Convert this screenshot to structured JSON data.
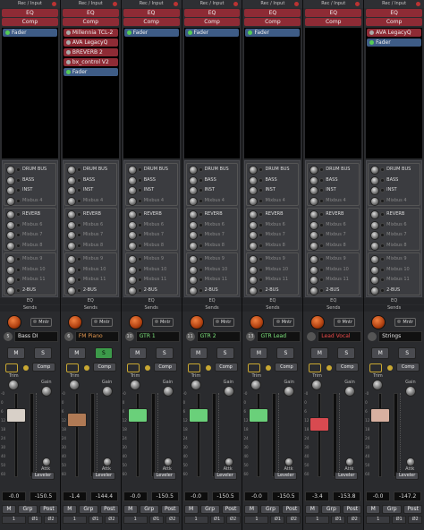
{
  "common": {
    "rec_input": "Rec / Input",
    "eq": "EQ",
    "comp": "Comp",
    "eq_section": "EQ",
    "sends_section": "Sends",
    "mntr": "Mntr",
    "m": "M",
    "s": "S",
    "comp_btn": "Comp",
    "trim": "Trim",
    "gain": "Gain",
    "attk": "Attk",
    "leveler": "Leveler",
    "mute": "M",
    "grp": "Grp",
    "post": "Post",
    "b1": "1",
    "o1": "Ø1",
    "o2": "Ø2",
    "scale": [
      "-0",
      "0",
      "6",
      "12",
      "18",
      "24",
      "30",
      "40",
      "50",
      "60"
    ]
  },
  "strips": [
    {
      "num": "5",
      "name": "Bass DI",
      "name_color": "#e8e8e8",
      "fader_cap": "#d8d0c8",
      "fader_pos": 0.78,
      "peak": "-0.0",
      "gain": "-150.5",
      "solo_on": false,
      "plugins": [
        {
          "label": "Fader",
          "style": "blue"
        }
      ],
      "sends": [
        "DRUM BUS",
        "BASS",
        "INST",
        "Mixbus 4",
        "REVERB",
        "Mixbus 6",
        "Mixbus 7",
        "Mixbus 8",
        "Mixbus 9",
        "Mixbus 10",
        "Mixbus 11",
        "2-BUS"
      ]
    },
    {
      "num": "6",
      "name": "FM Piano",
      "name_color": "#e89a50",
      "fader_cap": "#b07a55",
      "fader_pos": 0.72,
      "peak": "-1.4",
      "gain": "-144.4",
      "solo_on": true,
      "plugins": [
        {
          "label": "Millennia TCL-2",
          "style": "red"
        },
        {
          "label": "AVA LegacyQ",
          "style": "red"
        },
        {
          "label": "BREVERB 2",
          "style": "red"
        },
        {
          "label": "bx_control V2",
          "style": "red"
        },
        {
          "label": "Fader",
          "style": "blue"
        }
      ],
      "sends": [
        "DRUM BUS",
        "BASS",
        "INST",
        "Mixbus 4",
        "REVERB",
        "Mixbus 6",
        "Mixbus 7",
        "Mixbus 8",
        "Mixbus 9",
        "Mixbus 10",
        "Mixbus 11",
        "2-BUS"
      ]
    },
    {
      "num": "10",
      "name": "GTR 1",
      "name_color": "#7ee87e",
      "fader_cap": "#6ad07a",
      "fader_pos": 0.78,
      "peak": "-0.0",
      "gain": "-150.5",
      "solo_on": false,
      "plugins": [
        {
          "label": "Fader",
          "style": "blue"
        }
      ],
      "sends": [
        "DRUM BUS",
        "BASS",
        "INST",
        "Mixbus 4",
        "REVERB",
        "Mixbus 6",
        "Mixbus 7",
        "Mixbus 8",
        "Mixbus 9",
        "Mixbus 10",
        "Mixbus 11",
        "2-BUS"
      ]
    },
    {
      "num": "11",
      "name": "GTR 2",
      "name_color": "#7ee87e",
      "fader_cap": "#6ad07a",
      "fader_pos": 0.78,
      "peak": "-0.0",
      "gain": "-150.5",
      "solo_on": false,
      "plugins": [
        {
          "label": "Fader",
          "style": "blue"
        }
      ],
      "sends": [
        "DRUM BUS",
        "BASS",
        "INST",
        "Mixbus 4",
        "REVERB",
        "Mixbus 6",
        "Mixbus 7",
        "Mixbus 8",
        "Mixbus 9",
        "Mixbus 10",
        "Mixbus 11",
        "2-BUS"
      ]
    },
    {
      "num": "13",
      "name": "GTR Lead",
      "name_color": "#7ee87e",
      "fader_cap": "#6ad07a",
      "fader_pos": 0.78,
      "peak": "-0.0",
      "gain": "-150.5",
      "solo_on": false,
      "plugins": [
        {
          "label": "Fader",
          "style": "blue"
        }
      ],
      "sends": [
        "DRUM BUS",
        "BASS",
        "INST",
        "Mixbus 4",
        "REVERB",
        "Mixbus 6",
        "Mixbus 7",
        "Mixbus 8",
        "Mixbus 9",
        "Mixbus 10",
        "Mixbus 11",
        "2-BUS"
      ]
    },
    {
      "num": "",
      "name": "Lead Vocal",
      "name_color": "#ee4a4a",
      "fader_cap": "#d84a50",
      "fader_pos": 0.66,
      "peak": "-3.4",
      "gain": "-153.8",
      "solo_on": false,
      "plugins": [],
      "sends": [
        "DRUM BUS",
        "BASS",
        "INST",
        "Mixbus 4",
        "REVERB",
        "Mixbus 6",
        "Mixbus 7",
        "Mixbus 8",
        "Mixbus 9",
        "Mixbus 10",
        "Mixbus 11",
        "2-BUS"
      ]
    },
    {
      "num": "",
      "name": "Strings",
      "name_color": "#e8e8e8",
      "fader_cap": "#d8b0a0",
      "fader_pos": 0.78,
      "peak": "-0.0",
      "gain": "-147.2",
      "solo_on": false,
      "plugins": [
        {
          "label": "AVA LegacyQ",
          "style": "red"
        },
        {
          "label": "Fader",
          "style": "blue"
        }
      ],
      "sends": [
        "DRUM BUS",
        "BASS",
        "INST",
        "Mixbus 4",
        "REVERB",
        "Mixbus 6",
        "Mixbus 7",
        "Mixbus 8",
        "Mixbus 9",
        "Mixbus 10",
        "Mixbus 11",
        "2-BUS"
      ]
    }
  ]
}
